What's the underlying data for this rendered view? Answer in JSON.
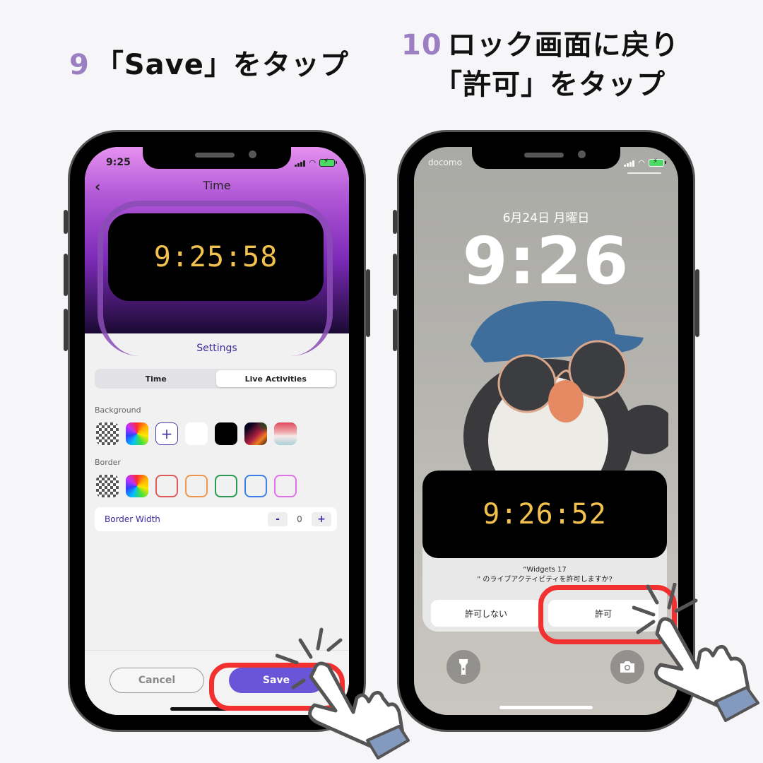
{
  "steps": [
    {
      "number": "9",
      "title_lines": [
        "「Save」をタップ"
      ]
    },
    {
      "number": "10",
      "title_lines": [
        "ロック画面に戻り",
        "「許可」をタップ"
      ]
    }
  ],
  "left_phone": {
    "status_time": "9:25",
    "nav": {
      "back_icon": "chevron-left-icon",
      "title": "Time"
    },
    "preview_clock": "9:25:58",
    "settings_title": "Settings",
    "segments": [
      {
        "label": "Time",
        "selected": false
      },
      {
        "label": "Live Activities",
        "selected": true
      }
    ],
    "background": {
      "label": "Background",
      "swatches": [
        "transparent",
        "color-wheel",
        "add-custom",
        "white",
        "black",
        "flame-image",
        "sky-image"
      ],
      "add_symbol": "+"
    },
    "border": {
      "label": "Border",
      "swatches": [
        "transparent",
        "color-wheel",
        "red",
        "orange",
        "green",
        "blue",
        "pink"
      ],
      "colors": {
        "red": "#e05a5a",
        "orange": "#f0954a",
        "green": "#2a9a50",
        "blue": "#3a80e8",
        "pink": "#e070e8"
      }
    },
    "border_width": {
      "label": "Border Width",
      "value": "0",
      "decrement": "-",
      "increment": "+"
    },
    "buttons": {
      "cancel": "Cancel",
      "save": "Save"
    }
  },
  "right_phone": {
    "carrier": "docomo",
    "date": "6月24日 月曜日",
    "time": "9:26",
    "live_activity_clock": "9:26:52",
    "prompt_line1": "“Widgets 17",
    "prompt_line2": "” のライブアクティビティを許可しますか?",
    "buttons": {
      "deny": "許可しない",
      "allow": "許可"
    },
    "quick_actions": [
      "flashlight-icon",
      "camera-icon"
    ]
  },
  "colors": {
    "accent_purple": "#9b7fc2",
    "save_button": "#6a55d8",
    "highlight_red": "#f23030",
    "clock_yellow": "#f2c14e"
  }
}
